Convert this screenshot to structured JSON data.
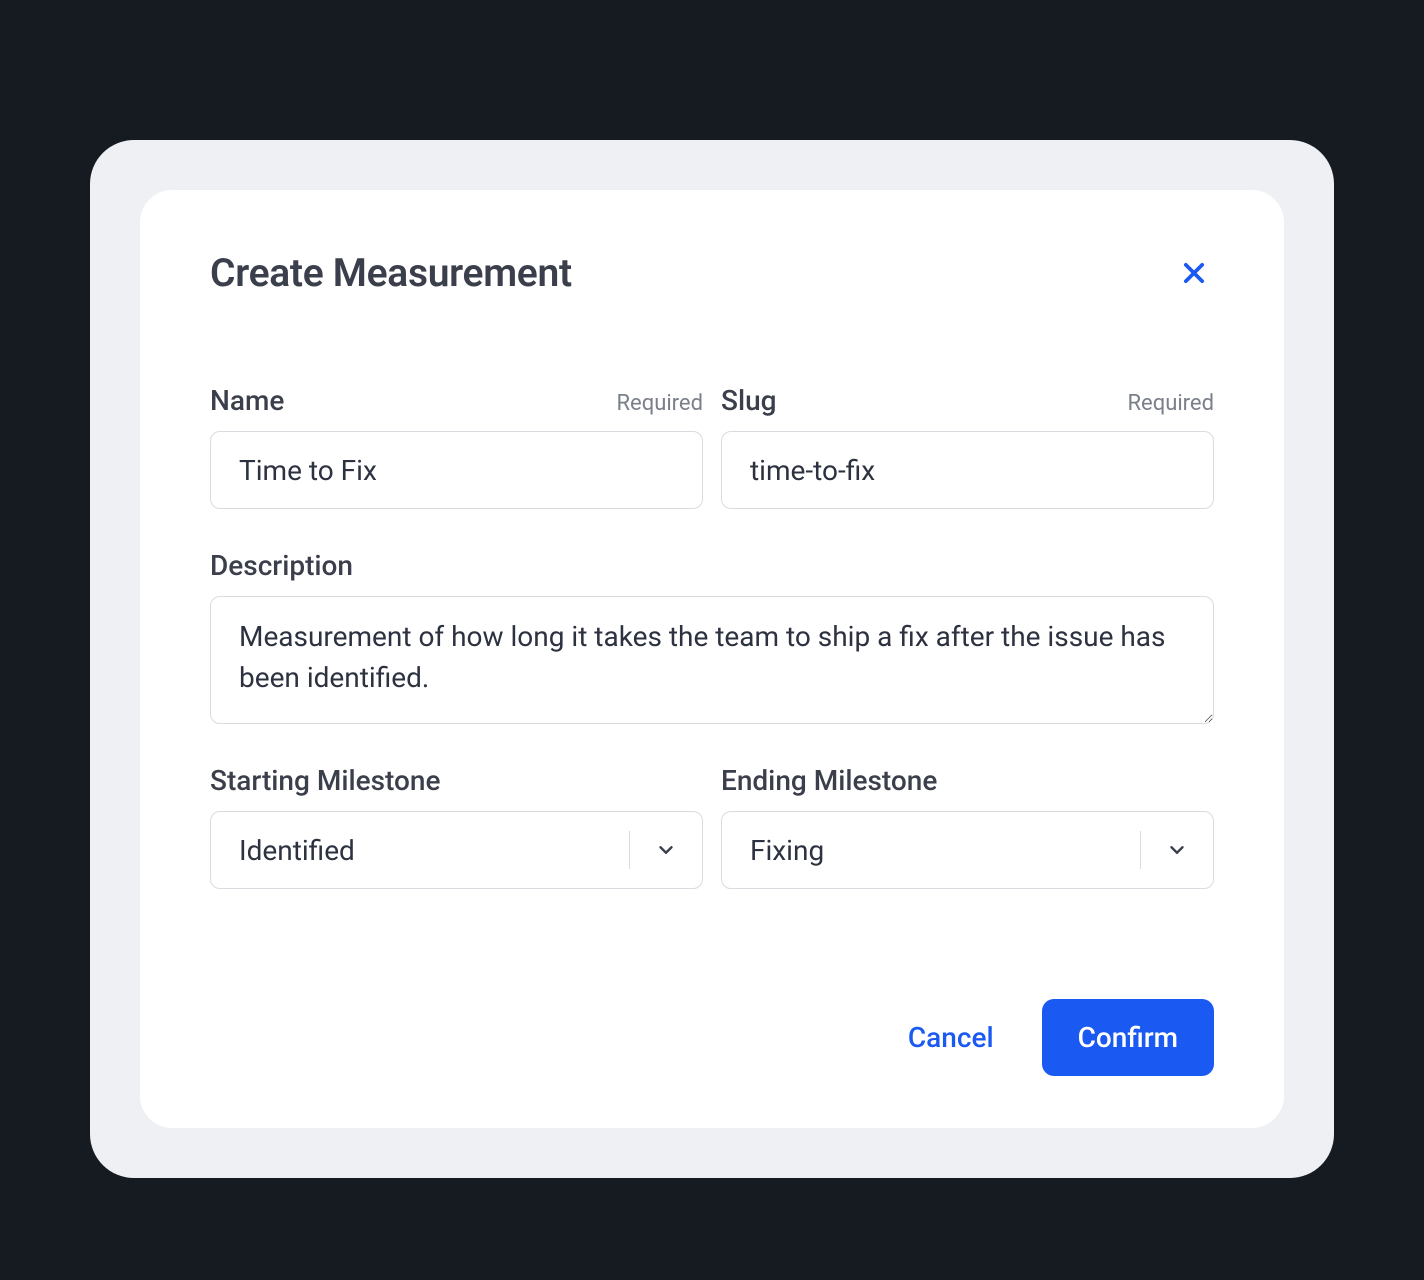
{
  "modal": {
    "title": "Create Measurement",
    "fields": {
      "name": {
        "label": "Name",
        "required_text": "Required",
        "value": "Time to Fix"
      },
      "slug": {
        "label": "Slug",
        "required_text": "Required",
        "value": "time-to-fix"
      },
      "description": {
        "label": "Description",
        "value": "Measurement of how long it takes the team to ship a fix after the issue has been identified."
      },
      "starting_milestone": {
        "label": "Starting Milestone",
        "value": "Identified"
      },
      "ending_milestone": {
        "label": "Ending Milestone",
        "value": "Fixing"
      }
    },
    "actions": {
      "cancel": "Cancel",
      "confirm": "Confirm"
    }
  }
}
